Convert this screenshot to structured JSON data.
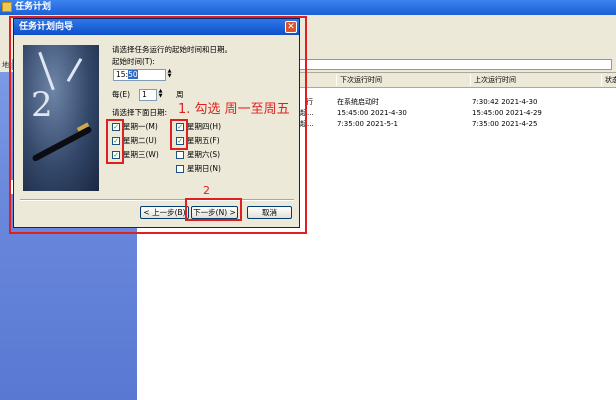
{
  "main_window": {
    "title": "任务计划",
    "address_label": "地址"
  },
  "task_list": {
    "columns": [
      "下次运行时间",
      "上次运行时间",
      "状态"
    ],
    "rows": [
      {
        "name_suffix": "行",
        "next_run": "在系统启动时",
        "last_run": "7:30:42  2021-4-30"
      },
      {
        "name_suffix": "起...",
        "next_run": "15:45:00  2021-4-30",
        "last_run": "15:45:00  2021-4-29"
      },
      {
        "name_suffix": "起...",
        "next_run": "7:35:00  2021-5-1",
        "last_run": "7:35:00  2021-4-25"
      }
    ]
  },
  "wizard": {
    "title": "任务计划向导",
    "close_glyph": "✕",
    "prompt": "请选择任务运行的起始时间和日期。",
    "start_time_label": "起始时间(T):",
    "start_time_hour": "15:",
    "start_time_minute": "50",
    "every_label": "每(E)",
    "every_value": "1",
    "every_unit": "周",
    "select_days_label": "请选择下面日期:",
    "days": [
      {
        "label": "星期一(M)",
        "checked": true
      },
      {
        "label": "星期二(U)",
        "checked": true
      },
      {
        "label": "星期三(W)",
        "checked": true
      },
      {
        "label": "星期四(H)",
        "checked": true
      },
      {
        "label": "星期五(F)",
        "checked": true
      },
      {
        "label": "星期六(S)",
        "checked": false
      },
      {
        "label": "星期日(N)",
        "checked": false
      }
    ],
    "check_glyph": "✓",
    "back_button": "< 上一步(B)",
    "next_button": "下一步(N) >",
    "cancel_button": "取消"
  },
  "annotations": {
    "step1": "1. 勾选  周一至周五",
    "step2": "2"
  },
  "colors": {
    "annotation_red": "#e02020",
    "title_blue": "#1c5fd6",
    "dialog_face": "#ece9d8",
    "left_panel": "#6a88dc"
  }
}
